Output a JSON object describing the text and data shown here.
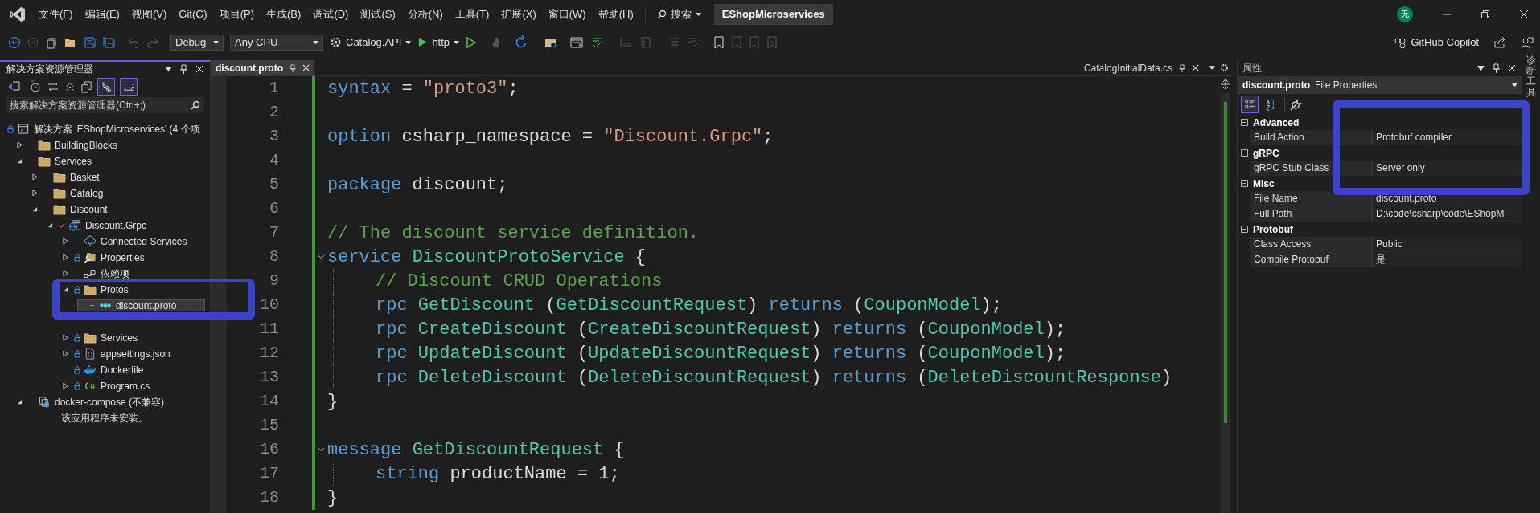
{
  "menu_bar": {
    "items": [
      "文件(F)",
      "编辑(E)",
      "视图(V)",
      "Git(G)",
      "项目(P)",
      "生成(B)",
      "调试(D)",
      "测试(S)",
      "分析(N)",
      "工具(T)",
      "扩展(X)",
      "窗口(W)",
      "帮助(H)"
    ],
    "search": "搜索",
    "solution_name": "EShopMicroservices",
    "account_initial": "无"
  },
  "toolbar": [
    {
      "kind": "dropdown",
      "label": "Debug"
    },
    {
      "kind": "dropdown",
      "label": "Any CPU"
    },
    {
      "kind": "startup",
      "label": "Catalog.API"
    },
    {
      "kind": "run",
      "label": "http"
    }
  ],
  "copilot": "GitHub Copilot",
  "solution_explorer": {
    "title": "解决方案资源管理器",
    "toggles": [
      {
        "kind": "sync",
        "selected": true
      },
      {
        "kind": "preview",
        "selected": true
      }
    ],
    "search": {
      "placeholder": "搜索解决方案资源管理器(Ctrl+;)"
    },
    "tree": {
      "label": "解决方案 'EShopMicroservices' (4 个项",
      "kind": "solution",
      "locked": true,
      "selected": false,
      "added": false,
      "checked_out": false,
      "children": [
        {
          "label": "BuildingBlocks",
          "kind": "folder",
          "locked": false,
          "selected": false,
          "added": false,
          "checked_out": false,
          "expanded": false
        },
        {
          "label": "Services",
          "kind": "folder",
          "locked": false,
          "selected": false,
          "added": false,
          "checked_out": false,
          "expanded": true,
          "children": [
            {
              "label": "Basket",
              "kind": "folder",
              "locked": false,
              "selected": false,
              "added": false,
              "checked_out": false,
              "expanded": false
            },
            {
              "label": "Catalog",
              "kind": "folder",
              "locked": false,
              "selected": false,
              "added": false,
              "checked_out": false,
              "expanded": false
            },
            {
              "label": "Discount",
              "kind": "folder",
              "locked": false,
              "selected": false,
              "added": false,
              "checked_out": false,
              "expanded": true,
              "children": [
                {
                  "label": "Discount.Grpc",
                  "kind": "project",
                  "locked": false,
                  "selected": false,
                  "added": false,
                  "checked_out": true,
                  "expanded": true,
                  "children": [
                    {
                      "label": "Connected Services",
                      "kind": "connected",
                      "locked": false,
                      "selected": false,
                      "added": false,
                      "checked_out": false,
                      "expanded": false
                    },
                    {
                      "label": "Properties",
                      "kind": "properties",
                      "locked": true,
                      "selected": false,
                      "added": false,
                      "checked_out": false,
                      "expanded": false
                    },
                    {
                      "label": "依赖项",
                      "kind": "dependencies",
                      "locked": false,
                      "selected": false,
                      "added": false,
                      "checked_out": false,
                      "expanded": false
                    },
                    {
                      "label": "Protos",
                      "kind": "folder",
                      "locked": true,
                      "selected": false,
                      "added": false,
                      "checked_out": false,
                      "expanded": true,
                      "children": [
                        {
                          "label": "discount.proto",
                          "kind": "proto",
                          "locked": false,
                          "selected": true,
                          "added": true,
                          "checked_out": false
                        }
                      ]
                    },
                    {
                      "label": "Services",
                      "kind": "folder",
                      "locked": true,
                      "selected": false,
                      "added": false,
                      "checked_out": false,
                      "expanded": false
                    },
                    {
                      "label": "appsettings.json",
                      "kind": "json",
                      "locked": true,
                      "selected": false,
                      "added": false,
                      "checked_out": false,
                      "expanded": false
                    },
                    {
                      "label": "Dockerfile",
                      "kind": "docker",
                      "locked": true,
                      "selected": false,
                      "added": false,
                      "checked_out": false
                    },
                    {
                      "label": "Program.cs",
                      "kind": "csharp",
                      "locked": true,
                      "selected": false,
                      "added": false,
                      "checked_out": false,
                      "expanded": false
                    }
                  ]
                }
              ]
            }
          ]
        },
        {
          "label": "docker-compose (不兼容)",
          "kind": "compose",
          "locked": false,
          "selected": false,
          "added": false,
          "checked_out": false,
          "expanded": true,
          "children": [
            {
              "label": "该应用程序未安装。",
              "kind": "message",
              "locked": false,
              "selected": false,
              "added": false,
              "checked_out": false
            }
          ]
        }
      ]
    }
  },
  "editor": {
    "tabs": [
      {
        "label": "discount.proto",
        "selected": true,
        "docked_right": false
      },
      {
        "label": "CatalogInitialData.cs",
        "selected": false,
        "docked_right": true
      }
    ],
    "lines": [
      {
        "number": "1",
        "fold": false,
        "indented": false,
        "tokens": [
          {
            "kind": "keyword",
            "text": "syntax"
          },
          {
            "kind": "plain",
            "text": " = "
          },
          {
            "kind": "string",
            "text": "\"proto3\""
          },
          {
            "kind": "plain",
            "text": ";"
          }
        ]
      },
      {
        "number": "2",
        "fold": false,
        "indented": false
      },
      {
        "number": "3",
        "fold": false,
        "indented": false,
        "tokens": [
          {
            "kind": "keyword",
            "text": "option"
          },
          {
            "kind": "plain",
            "text": " csharp_namespace = "
          },
          {
            "kind": "string",
            "text": "\"Discount.Grpc\""
          },
          {
            "kind": "plain",
            "text": ";"
          }
        ]
      },
      {
        "number": "4",
        "fold": false,
        "indented": false
      },
      {
        "number": "5",
        "fold": false,
        "indented": false,
        "tokens": [
          {
            "kind": "keyword",
            "text": "package"
          },
          {
            "kind": "plain",
            "text": " discount;"
          }
        ]
      },
      {
        "number": "6",
        "fold": false,
        "indented": false
      },
      {
        "number": "7",
        "fold": false,
        "indented": false,
        "tokens": [
          {
            "kind": "comment",
            "text": "// The discount service definition."
          }
        ]
      },
      {
        "number": "8",
        "fold": true,
        "indented": false,
        "tokens": [
          {
            "kind": "keyword",
            "text": "service "
          },
          {
            "kind": "type",
            "text": "DiscountProtoService"
          },
          {
            "kind": "plain",
            "text": " {"
          }
        ]
      },
      {
        "number": "9",
        "fold": false,
        "indented": true,
        "tokens": [
          {
            "kind": "comment",
            "text": "// Discount CRUD Operations"
          }
        ]
      },
      {
        "number": "10",
        "fold": false,
        "indented": true,
        "tokens": [
          {
            "kind": "keyword",
            "text": "rpc "
          },
          {
            "kind": "type",
            "text": "GetDiscount"
          },
          {
            "kind": "plain",
            "text": " ("
          },
          {
            "kind": "type",
            "text": "GetDiscountRequest"
          },
          {
            "kind": "plain",
            "text": ") "
          },
          {
            "kind": "keyword",
            "text": "returns"
          },
          {
            "kind": "plain",
            "text": " ("
          },
          {
            "kind": "type",
            "text": "CouponModel"
          },
          {
            "kind": "plain",
            "text": ");"
          }
        ]
      },
      {
        "number": "11",
        "fold": false,
        "indented": true,
        "tokens": [
          {
            "kind": "keyword",
            "text": "rpc "
          },
          {
            "kind": "type",
            "text": "CreateDiscount"
          },
          {
            "kind": "plain",
            "text": " ("
          },
          {
            "kind": "type",
            "text": "CreateDiscountRequest"
          },
          {
            "kind": "plain",
            "text": ") "
          },
          {
            "kind": "keyword",
            "text": "returns"
          },
          {
            "kind": "plain",
            "text": " ("
          },
          {
            "kind": "type",
            "text": "CouponModel"
          },
          {
            "kind": "plain",
            "text": ");"
          }
        ]
      },
      {
        "number": "12",
        "fold": false,
        "indented": true,
        "tokens": [
          {
            "kind": "keyword",
            "text": "rpc "
          },
          {
            "kind": "type",
            "text": "UpdateDiscount"
          },
          {
            "kind": "plain",
            "text": " ("
          },
          {
            "kind": "type",
            "text": "UpdateDiscountRequest"
          },
          {
            "kind": "plain",
            "text": ") "
          },
          {
            "kind": "keyword",
            "text": "returns"
          },
          {
            "kind": "plain",
            "text": " ("
          },
          {
            "kind": "type",
            "text": "CouponModel"
          },
          {
            "kind": "plain",
            "text": ");"
          }
        ]
      },
      {
        "number": "13",
        "fold": false,
        "indented": true,
        "tokens": [
          {
            "kind": "keyword",
            "text": "rpc "
          },
          {
            "kind": "type",
            "text": "DeleteDiscount"
          },
          {
            "kind": "plain",
            "text": " ("
          },
          {
            "kind": "type",
            "text": "DeleteDiscountRequest"
          },
          {
            "kind": "plain",
            "text": ") "
          },
          {
            "kind": "keyword",
            "text": "returns"
          },
          {
            "kind": "plain",
            "text": " ("
          },
          {
            "kind": "type",
            "text": "DeleteDiscountResponse"
          },
          {
            "kind": "plain",
            "text": ")"
          }
        ]
      },
      {
        "number": "14",
        "fold": false,
        "indented": false,
        "tokens": [
          {
            "kind": "plain",
            "text": "}"
          }
        ]
      },
      {
        "number": "15",
        "fold": false,
        "indented": false
      },
      {
        "number": "16",
        "fold": true,
        "indented": false,
        "tokens": [
          {
            "kind": "keyword",
            "text": "message "
          },
          {
            "kind": "type",
            "text": "GetDiscountRequest"
          },
          {
            "kind": "plain",
            "text": " {"
          }
        ]
      },
      {
        "number": "17",
        "fold": false,
        "indented": true,
        "tokens": [
          {
            "kind": "keyword",
            "text": "string"
          },
          {
            "kind": "plain",
            "text": " productName = 1;"
          }
        ]
      },
      {
        "number": "18",
        "fold": false,
        "indented": false,
        "tokens": [
          {
            "kind": "plain",
            "text": "}"
          }
        ]
      }
    ]
  },
  "properties": {
    "title": "属性",
    "object_name": "discount.proto",
    "object_type": "File Properties",
    "views": [
      {
        "kind": "categorized",
        "selected": true
      },
      {
        "kind": "alphabetical",
        "selected": false
      }
    ],
    "categories": [
      {
        "name": "Advanced",
        "expanded": true,
        "rows": [
          {
            "name": "Build Action",
            "value": "Protobuf compiler"
          }
        ]
      },
      {
        "name": "gRPC",
        "expanded": true,
        "rows": [
          {
            "name": "gRPC Stub Class",
            "value": "Server only"
          }
        ]
      },
      {
        "name": "Misc",
        "expanded": true,
        "rows": [
          {
            "name": "File Name",
            "value": "discount.proto"
          },
          {
            "name": "Full Path",
            "value": "D:\\code\\csharp\\code\\EShopM"
          }
        ]
      },
      {
        "name": "Protobuf",
        "expanded": true,
        "rows": [
          {
            "name": "Class Access",
            "value": "Public"
          },
          {
            "name": "Compile Protobuf",
            "value": "是"
          }
        ]
      }
    ]
  },
  "side_tab": "诊断工具",
  "highlights": {
    "solution_explorer": true,
    "properties": true
  }
}
